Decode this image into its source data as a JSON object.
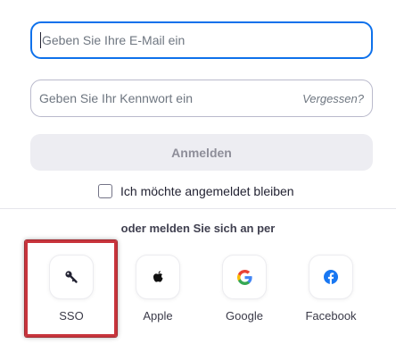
{
  "form": {
    "email_placeholder": "Geben Sie Ihre E-Mail ein",
    "password_placeholder": "Geben Sie Ihr Kennwort ein",
    "forgot_label": "Vergessen?",
    "signin_label": "Anmelden",
    "remember_label": "Ich möchte angemeldet bleiben",
    "remember_checked": false
  },
  "alt_signin": {
    "heading": "oder melden Sie sich an per",
    "providers": [
      {
        "label": "SSO",
        "icon": "key-icon"
      },
      {
        "label": "Apple",
        "icon": "apple-icon"
      },
      {
        "label": "Google",
        "icon": "google-icon"
      },
      {
        "label": "Facebook",
        "icon": "facebook-icon"
      }
    ]
  },
  "colors": {
    "focus_border": "#0e71eb",
    "highlight": "#c8343c",
    "facebook": "#1877f2"
  }
}
